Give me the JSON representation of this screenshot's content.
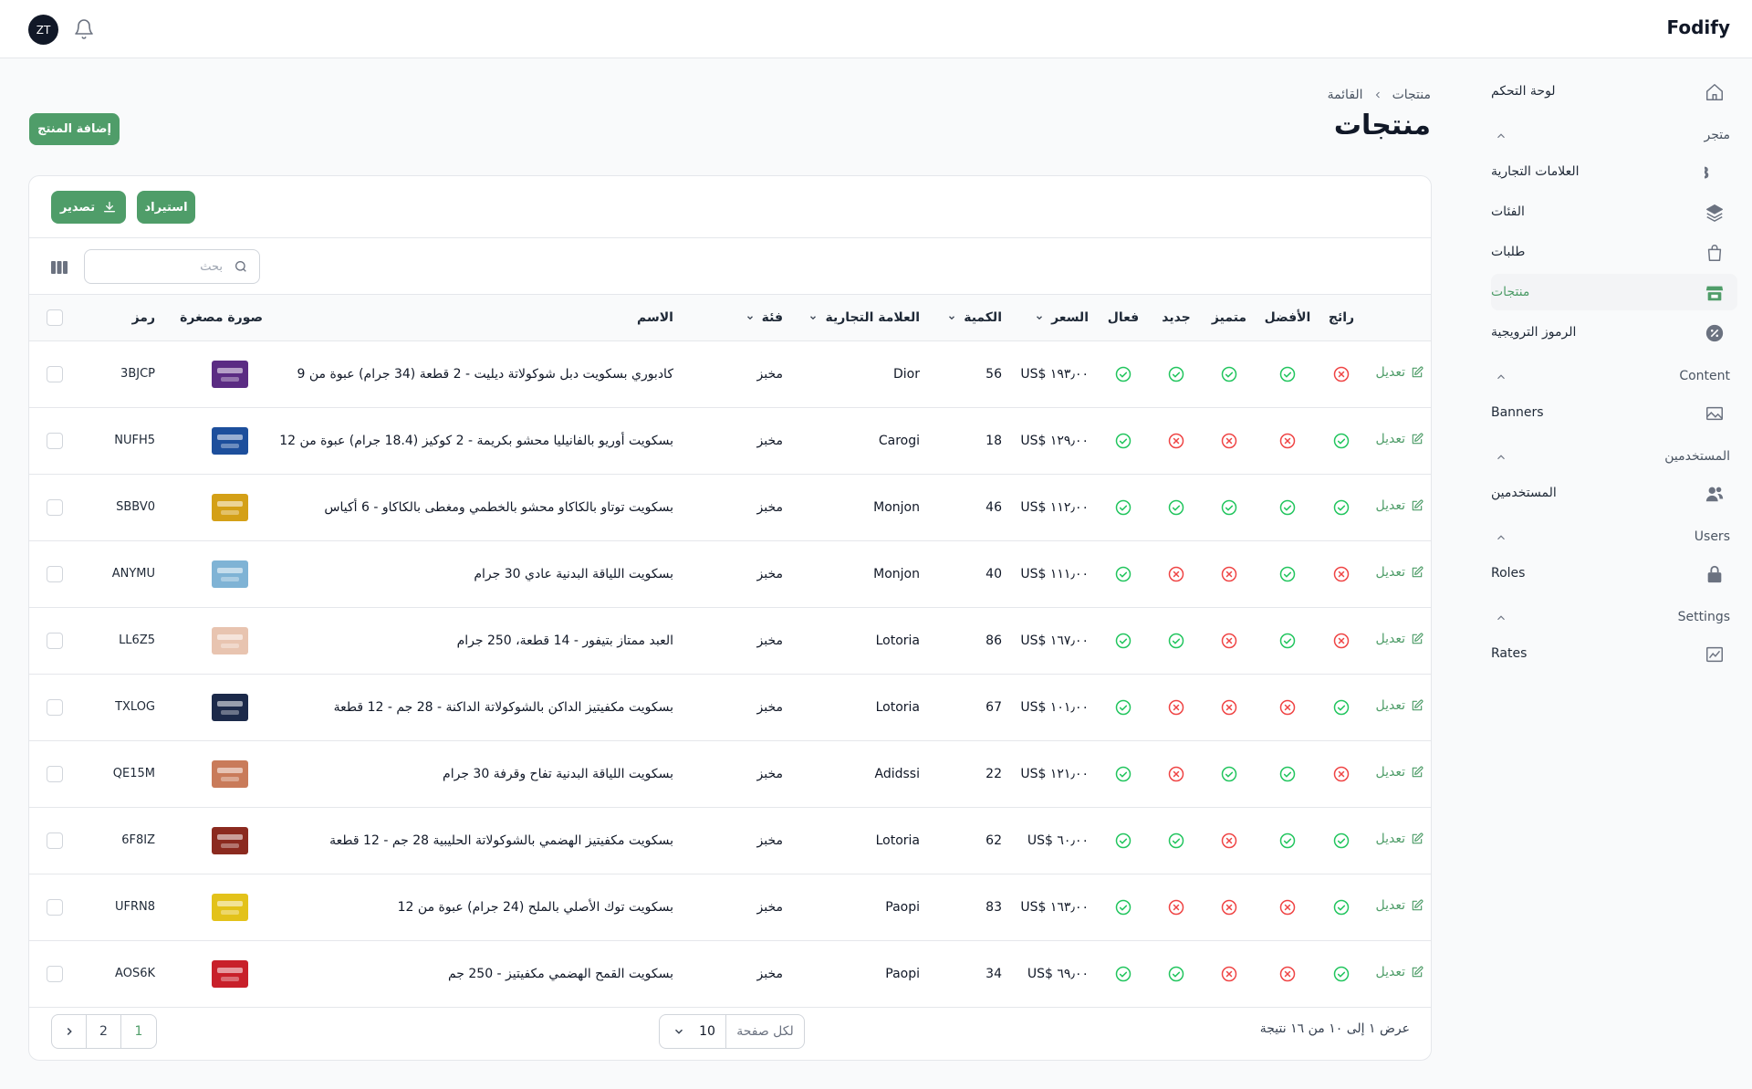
{
  "app": {
    "logo": "Fodify",
    "avatar_initials": "ZT"
  },
  "sidebar": {
    "dashboard": "لوحة التحكم",
    "groups": [
      {
        "title": "متجر",
        "items": [
          {
            "label": "العلامات التجارية",
            "icon": "brand-b-icon"
          },
          {
            "label": "الفئات",
            "icon": "layers-icon"
          },
          {
            "label": "طلبات",
            "icon": "shopping-bag-icon"
          },
          {
            "label": "منتجات",
            "icon": "store-icon",
            "active": true
          },
          {
            "label": "الرموز الترويجية",
            "icon": "discount-icon"
          }
        ]
      },
      {
        "title": "Content",
        "items": [
          {
            "label": "Banners",
            "icon": "image-icon"
          }
        ]
      },
      {
        "title": "المستخدمين",
        "items": [
          {
            "label": "المستخدمين",
            "icon": "users-icon"
          }
        ]
      },
      {
        "title": "Users",
        "items": [
          {
            "label": "Roles",
            "icon": "lock-icon"
          }
        ]
      },
      {
        "title": "Settings",
        "items": [
          {
            "label": "Rates",
            "icon": "chart-icon"
          }
        ]
      }
    ]
  },
  "header": {
    "breadcrumb": [
      "منتجات",
      "القائمة"
    ],
    "title": "منتجات",
    "add_button": "إضافة المنتج"
  },
  "toolbar": {
    "import_label": "استيراد",
    "export_label": "تصدير",
    "search_placeholder": "بحث"
  },
  "table": {
    "columns": {
      "code": "رمز",
      "thumb": "صورة مصغرة",
      "name": "الاسم",
      "category": "فئة",
      "brand": "العلامة التجارية",
      "qty": "الكمية",
      "price": "السعر",
      "active": "فعال",
      "new": "جديد",
      "featured": "متميز",
      "best": "الأفضل",
      "popular": "رائج"
    },
    "edit_label": "تعديل",
    "rows": [
      {
        "code": "3BJCP",
        "name": "كادبوري بسكويت دبل شوكولاتة ديليت - 2 قطعة (34 جرام) عبوة من 9",
        "category": "مخبز",
        "brand": "Dior",
        "qty": "56",
        "price": "US$ ١٩٣٫٠٠",
        "flags": [
          true,
          true,
          true,
          true,
          false
        ],
        "thumb_color": "#5b2c83"
      },
      {
        "code": "NUFH5",
        "name": "بسكويت أوريو بالفانيليا محشو بكريمة - 2 كوكيز (18.4 جرام) عبوة من 12",
        "category": "مخبز",
        "brand": "Carogi",
        "qty": "18",
        "price": "US$ ١٢٩٫٠٠",
        "flags": [
          true,
          false,
          false,
          false,
          true
        ],
        "thumb_color": "#1d4f9c"
      },
      {
        "code": "SBBV0",
        "name": "بسكويت توتاو بالكاكاو محشو بالخطمي ومغطى بالكاكاو - 6 أكياس",
        "category": "مخبز",
        "brand": "Monjon",
        "qty": "46",
        "price": "US$ ١١٢٫٠٠",
        "flags": [
          true,
          true,
          true,
          true,
          true
        ],
        "thumb_color": "#d4a017"
      },
      {
        "code": "ANYMU",
        "name": "بسكويت اللياقة البدنية عادي 30 جرام",
        "category": "مخبز",
        "brand": "Monjon",
        "qty": "40",
        "price": "US$ ١١١٫٠٠",
        "flags": [
          true,
          false,
          false,
          true,
          false
        ],
        "thumb_color": "#7fb3d5"
      },
      {
        "code": "LL6Z5",
        "name": "العبد ممتاز بتيفور - 14 قطعة، 250 جرام",
        "category": "مخبز",
        "brand": "Lotoria",
        "qty": "86",
        "price": "US$ ١٦٧٫٠٠",
        "flags": [
          true,
          true,
          false,
          true,
          false
        ],
        "thumb_color": "#e8c4b0"
      },
      {
        "code": "TXLOG",
        "name": "بسكويت مكفيتيز الداكن بالشوكولاتة الداكنة - 28 جم - 12 قطعة",
        "category": "مخبز",
        "brand": "Lotoria",
        "qty": "67",
        "price": "US$ ١٠١٫٠٠",
        "flags": [
          true,
          false,
          false,
          false,
          true
        ],
        "thumb_color": "#1c2a4a"
      },
      {
        "code": "QE15M",
        "name": "بسكويت اللياقة البدنية تفاح وقرفة 30 جرام",
        "category": "مخبز",
        "brand": "Adidssi",
        "qty": "22",
        "price": "US$ ١٢١٫٠٠",
        "flags": [
          true,
          false,
          true,
          true,
          false
        ],
        "thumb_color": "#c97b5a"
      },
      {
        "code": "6F8IZ",
        "name": "بسكويت مكفيتيز الهضمي بالشوكولاتة الحليبية 28 جم - 12 قطعة",
        "category": "مخبز",
        "brand": "Lotoria",
        "qty": "62",
        "price": "US$ ٦٠٫٠٠",
        "flags": [
          true,
          true,
          false,
          true,
          true
        ],
        "thumb_color": "#8b2a1f"
      },
      {
        "code": "UFRN8",
        "name": "بسكويت توك الأصلي بالملح (24 جرام) عبوة من 12",
        "category": "مخبز",
        "brand": "Paopi",
        "qty": "83",
        "price": "US$ ١٦٣٫٠٠",
        "flags": [
          true,
          false,
          false,
          false,
          true
        ],
        "thumb_color": "#e3c21a"
      },
      {
        "code": "AOS6K",
        "name": "بسكويت القمح الهضمي مكفيتيز - 250 جم",
        "category": "مخبز",
        "brand": "Paopi",
        "qty": "34",
        "price": "US$ ٦٩٫٠٠",
        "flags": [
          true,
          true,
          false,
          false,
          true
        ],
        "thumb_color": "#c8202a"
      }
    ]
  },
  "footer": {
    "results": "عرض ١ إلى ١٠ من ١٦ نتيجة",
    "per_page_label": "لكل صفحة",
    "per_page_value": "10",
    "pages": [
      "1",
      "2"
    ]
  },
  "colors": {
    "accent": "#4f9d69",
    "success": "#22c55e",
    "danger": "#ef4444"
  }
}
